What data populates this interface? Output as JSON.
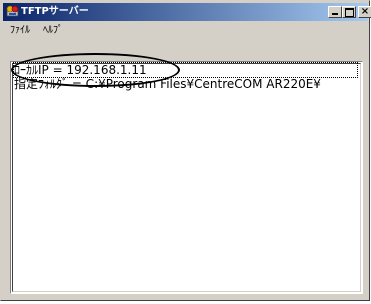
{
  "window": {
    "title": "TFTPサーバー",
    "icon": "tftp-app-icon",
    "controls": {
      "minimize_icon": "minimize-icon",
      "maximize_icon": "maximize-icon",
      "close_icon": "close-icon",
      "close_glyph": "×"
    }
  },
  "menu": {
    "items": [
      {
        "label": "ﾌｧｲﾙ"
      },
      {
        "label": "ﾍﾙﾌﾟ"
      }
    ]
  },
  "log": {
    "lines": [
      {
        "text": "ﾛｰｶﾙIP = 192.168.1.11"
      },
      {
        "text": "指定ﾌｫﾙﾀﾞ = C:¥Program Files¥CentreCOM AR220E¥"
      }
    ]
  },
  "colors": {
    "title_gradient_start": "#0a246a",
    "title_gradient_end": "#a6caf0",
    "window_face": "#d4d0c8",
    "annotation": "#000000"
  }
}
